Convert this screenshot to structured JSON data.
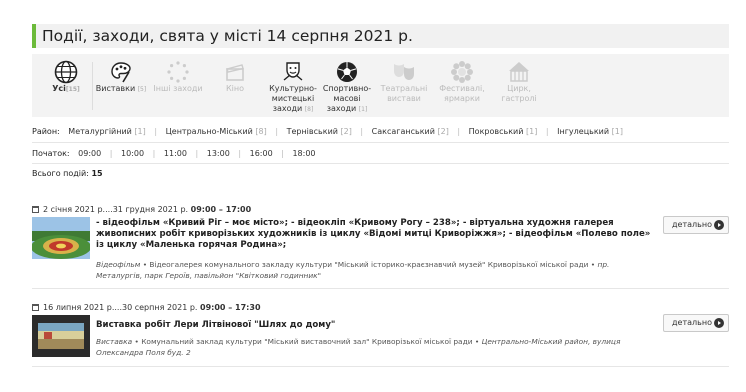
{
  "header": {
    "title": "Події, заходи, свята у місті 14 серпня 2021 р."
  },
  "categories": [
    {
      "label": "Усі",
      "count": "[15]",
      "icon": "globe-icon",
      "active": true,
      "disabled": false
    },
    {
      "label": "Виставки",
      "count": "[5]",
      "icon": "palette-icon",
      "active": false,
      "disabled": false
    },
    {
      "label": "Інші заходи",
      "count": "",
      "icon": "loading-circle-icon",
      "active": false,
      "disabled": true
    },
    {
      "label": "Кіно",
      "count": "",
      "icon": "clapperboard-icon",
      "active": false,
      "disabled": true
    },
    {
      "label": "Культурно-мистецькі заходи",
      "count": "[8]",
      "icon": "culture-icon",
      "active": false,
      "disabled": false
    },
    {
      "label": "Спортивно-масові заходи",
      "count": "[1]",
      "icon": "soccer-ball-icon",
      "active": false,
      "disabled": false
    },
    {
      "label": "Театральні вистави",
      "count": "",
      "icon": "theatre-masks-icon",
      "active": false,
      "disabled": true
    },
    {
      "label": "Фестивалі, ярмарки",
      "count": "",
      "icon": "festival-flower-icon",
      "active": false,
      "disabled": true
    },
    {
      "label": "Цирк, гастролі",
      "count": "",
      "icon": "circus-tent-icon",
      "active": false,
      "disabled": true
    }
  ],
  "district": {
    "label": "Район:",
    "options": [
      {
        "name": "Металургійний",
        "count": "[1]"
      },
      {
        "name": "Центрально-Міський",
        "count": "[8]"
      },
      {
        "name": "Тернівський",
        "count": "[2]"
      },
      {
        "name": "Саксаганський",
        "count": "[2]"
      },
      {
        "name": "Покровський",
        "count": "[1]"
      },
      {
        "name": "Інгулецький",
        "count": "[1]"
      }
    ]
  },
  "start": {
    "label": "Початок:",
    "options": [
      "09:00",
      "10:00",
      "11:00",
      "13:00",
      "16:00",
      "18:00"
    ]
  },
  "total": {
    "label": "Всього подій:",
    "value": "15"
  },
  "events": [
    {
      "date": "2 січня 2021 р....31 грудня 2021 р.",
      "time": "09:00 – 17:00",
      "title": "- відеофільм «Кривий Ріг – моє місто»; - відеокліп «Кривому Рогу – 238»; - віртуальна художня галерея живописних робіт криворізьких художників із циклу «Відомі митці Криворіжжя»; - відеофільм «Полево поле» із циклу «Маленька горячая Родина»;",
      "type": "Відеофільм",
      "organizer": "Відеогалерея комунального закладу культури \"Міський історико-краєзнавчий музей\" Криворізької міської ради",
      "address": "пр. Металургів, парк Героїв, павільйон \"Квітковий годинник\"",
      "button": "детально"
    },
    {
      "date": "16 липня 2021 р....30 серпня 2021 р.",
      "time": "09:00 – 17:30",
      "title": "Виставка робіт Лери Літвінової \"Шлях до дому\"",
      "type": "Виставка",
      "organizer": "Комунальний заклад культури \"Міський виставочний зал\" Криворізької міської ради",
      "address": "Центрально-Міський район, вулиця Олександра Поля буд. 2",
      "button": "детально"
    }
  ],
  "colors": {
    "accent": "#6cba3a",
    "header_bg": "#f1f1f1",
    "panel_bg": "#f3f3f3"
  }
}
